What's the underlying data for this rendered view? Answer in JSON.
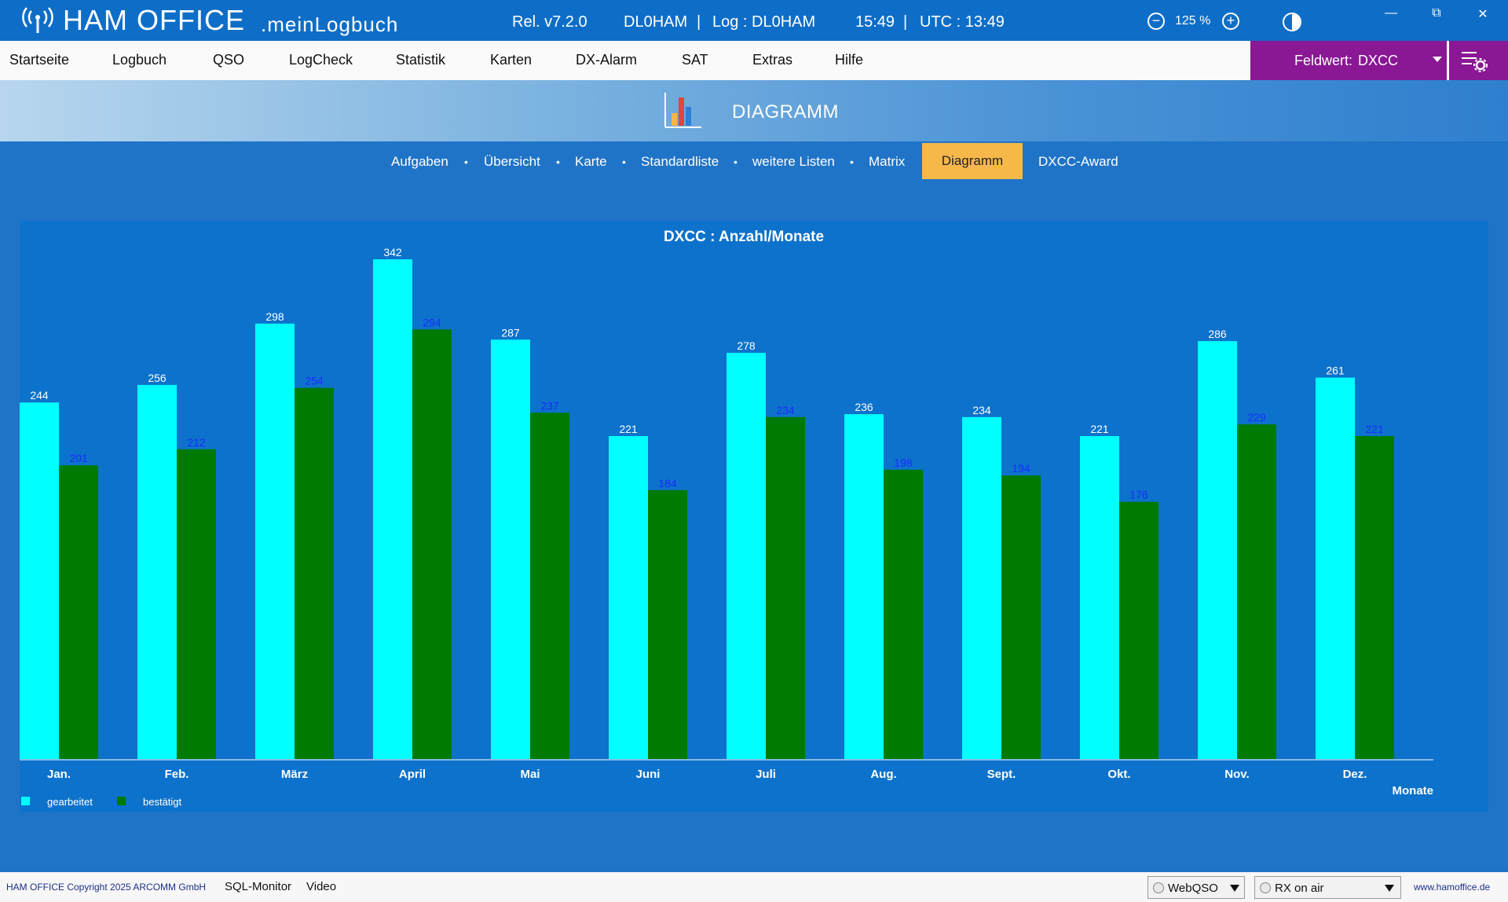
{
  "window": {
    "app_name": "HAM OFFICE",
    "app_sub": ".meinLogbuch",
    "release": "Rel. v7.2.0",
    "callsign": "DL0HAM",
    "separator": "|",
    "log": "Log : DL0HAM",
    "time": "15:49",
    "utc": "UTC : 13:49",
    "zoom": "125 %",
    "zoom_out": "−",
    "zoom_in": "+",
    "minimize": "—",
    "restore": "⧉",
    "close": "✕"
  },
  "menu": {
    "items": [
      "Startseite",
      "Logbuch",
      "QSO",
      "LogCheck",
      "Statistik",
      "Karten",
      "DX-Alarm",
      "SAT",
      "Extras",
      "Hilfe"
    ],
    "field_label": "Feldwert:",
    "field_value": "DXCC"
  },
  "header": {
    "title": "DIAGRAMM"
  },
  "subnav": {
    "items": [
      "Aufgaben",
      "Übersicht",
      "Karte",
      "Standardliste",
      "weitere Listen",
      "Matrix",
      "Diagramm",
      "DXCC-Award"
    ],
    "active_index": 6
  },
  "chart_data": {
    "type": "bar",
    "title": "DXCC : Anzahl/Monate",
    "xlabel": "Monate",
    "ylabel": "",
    "categories": [
      "Jan.",
      "Feb.",
      "März",
      "April",
      "Mai",
      "Juni",
      "Juli",
      "Aug.",
      "Sept.",
      "Okt.",
      "Nov.",
      "Dez."
    ],
    "series": [
      {
        "name": "gearbeitet",
        "color": "#00ffff",
        "label_color": "#ffffff",
        "values": [
          244,
          256,
          298,
          342,
          287,
          221,
          278,
          236,
          234,
          221,
          286,
          261
        ]
      },
      {
        "name": "bestätigt",
        "color": "#007a00",
        "label_color": "#1a2cff",
        "values": [
          201,
          212,
          254,
          294,
          237,
          184,
          234,
          198,
          194,
          176,
          229,
          221
        ]
      }
    ],
    "ylim": [
      0,
      342
    ],
    "grid": false,
    "legend": "bottom-left"
  },
  "statusbar": {
    "copyright": "HAM OFFICE Copyright 2025 ARCOMM GmbH",
    "sql_monitor": "SQL-Monitor",
    "video": "Video",
    "webqso": "WebQSO",
    "rx": "RX on air",
    "url": "www.hamoffice.de"
  },
  "colors": {
    "titlebar": "#0e6ec7",
    "accent_purple": "#8a1794",
    "active_tab": "#f7b84a",
    "panel": "#0d72cb"
  }
}
